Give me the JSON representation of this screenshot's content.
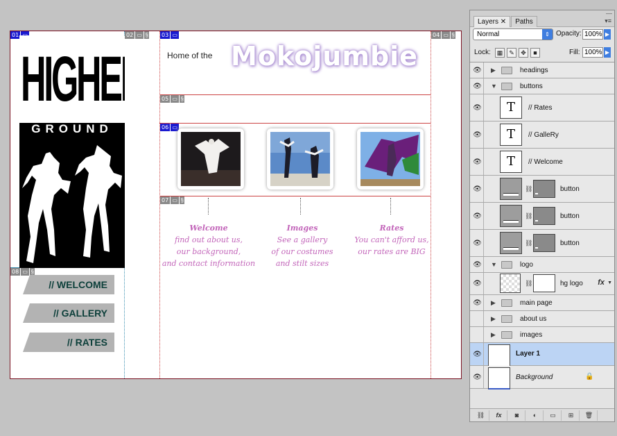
{
  "canvas": {
    "slices": [
      "01",
      "02",
      "03",
      "04",
      "05",
      "06",
      "07",
      "08"
    ],
    "logo": {
      "line1": "HIGHER",
      "line2": "GROUND"
    },
    "nav": [
      "// WELCOME",
      "// GALLERY",
      "// RATES"
    ],
    "home_of": "Home of the",
    "site_title": "Mokojumbie",
    "captions": [
      {
        "head": "Welcome",
        "lines": [
          "find out about us,",
          "our background,",
          "and contact information"
        ]
      },
      {
        "head": "Images",
        "lines": [
          "See a gallery",
          "of our costumes",
          "and stilt sizes"
        ]
      },
      {
        "head": "Rates",
        "lines": [
          "You can't afford us,",
          "our rates are BIG"
        ]
      }
    ],
    "colors": {
      "caption": "#c264b9",
      "nav_text": "#0c3f3a",
      "title_glow": "#b49ad8"
    }
  },
  "panel": {
    "tabs": [
      "Layers",
      "Paths"
    ],
    "active_tab": "Layers",
    "blend_mode": "Normal",
    "opacity_label": "Opacity:",
    "opacity": "100%",
    "fill_label": "Fill:",
    "fill": "100%",
    "lock_label": "Lock:",
    "layers": [
      {
        "name": "headings",
        "type": "group",
        "expanded": false,
        "visible": true
      },
      {
        "name": "buttons",
        "type": "group",
        "expanded": true,
        "visible": true
      },
      {
        "name": "// Rates",
        "type": "text",
        "visible": true
      },
      {
        "name": "// GalleRy",
        "type": "text",
        "visible": true
      },
      {
        "name": "// Welcome",
        "type": "text",
        "visible": true
      },
      {
        "name": "button",
        "type": "masked",
        "visible": true
      },
      {
        "name": "button",
        "type": "masked",
        "visible": true
      },
      {
        "name": "button",
        "type": "masked",
        "visible": true
      },
      {
        "name": "logo",
        "type": "group",
        "expanded": true,
        "visible": true
      },
      {
        "name": "hg logo",
        "type": "fx",
        "visible": true
      },
      {
        "name": "main page",
        "type": "group",
        "expanded": false,
        "visible": true
      },
      {
        "name": "about us",
        "type": "group",
        "expanded": false,
        "visible": false
      },
      {
        "name": "images",
        "type": "group",
        "expanded": false,
        "visible": false
      },
      {
        "name": "Layer 1",
        "type": "pixel",
        "visible": true,
        "selected": true
      },
      {
        "name": "Background",
        "type": "background",
        "visible": true
      }
    ],
    "text_thumb_glyph": "T",
    "fx_label": "fx",
    "icons": [
      "link-icon",
      "fx-icon",
      "mask-icon",
      "adjustment-icon",
      "group-icon",
      "new-layer-icon",
      "trash-icon"
    ]
  }
}
